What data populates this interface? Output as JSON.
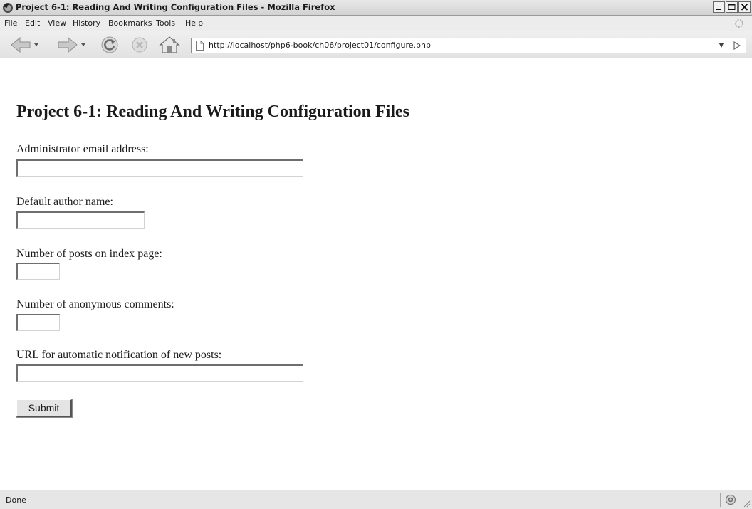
{
  "window": {
    "title": "Project 6-1: Reading And Writing Configuration Files - Mozilla Firefox",
    "controls": {
      "minimize": "_",
      "maximize": "□",
      "close": "X"
    }
  },
  "menubar": {
    "items": [
      {
        "label": "File"
      },
      {
        "label": "Edit"
      },
      {
        "label": "View"
      },
      {
        "label": "History"
      },
      {
        "label": "Bookmarks"
      },
      {
        "label": "Tools"
      },
      {
        "label": "Help"
      }
    ]
  },
  "toolbar": {
    "icons": [
      "back-icon",
      "forward-icon",
      "reload-icon",
      "stop-icon",
      "home-icon"
    ],
    "url": "http://localhost/php6-book/ch06/project01/configure.php"
  },
  "page": {
    "heading": "Project 6-1: Reading And Writing Configuration Files",
    "fields": [
      {
        "label": "Administrator email address:",
        "value": "",
        "placeholder": ""
      },
      {
        "label": "Default author name:",
        "value": "",
        "placeholder": ""
      },
      {
        "label": "Number of posts on index page:",
        "value": "",
        "placeholder": ""
      },
      {
        "label": "Number of anonymous comments:",
        "value": "",
        "placeholder": ""
      },
      {
        "label": "URL for automatic notification of new posts:",
        "value": "",
        "placeholder": ""
      }
    ],
    "submit_label": "Submit"
  },
  "statusbar": {
    "text": "Done"
  }
}
